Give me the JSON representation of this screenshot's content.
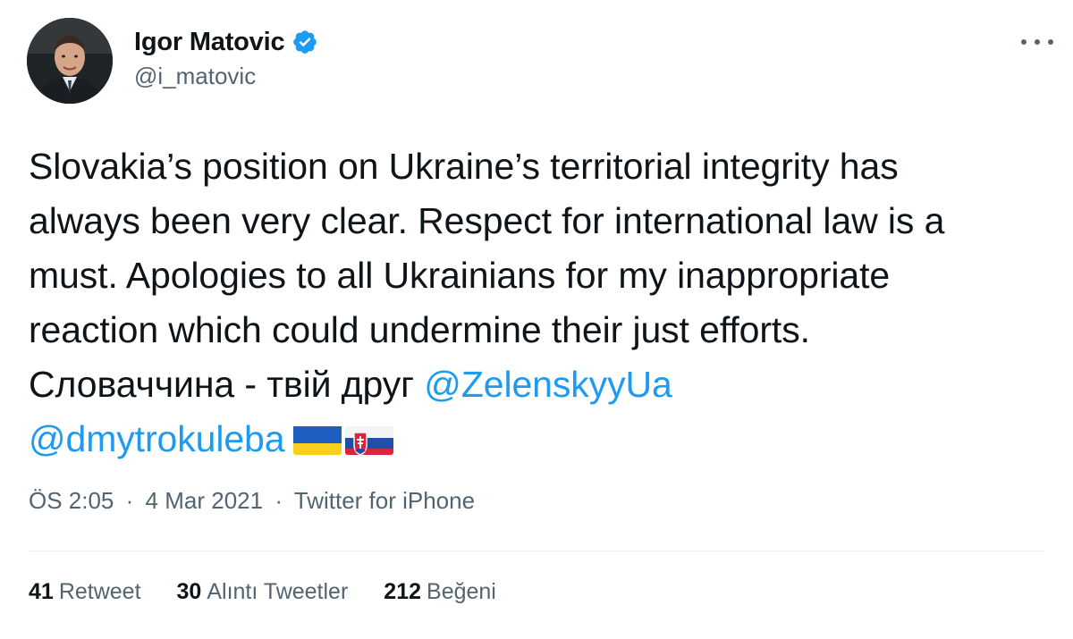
{
  "author": {
    "display_name": "Igor Matovic",
    "handle": "@i_matovic",
    "verified": true
  },
  "tweet": {
    "lines": [
      "Slovakia’s position on Ukraine’s territorial integrity has",
      "always been very clear. Respect for international law is a",
      "must. Apologies to all Ukrainians for my inappropriate",
      "reaction which could undermine their just efforts."
    ],
    "line5_text": "Словаччина - твій друг ",
    "mention_1": "@ZelenskyyUa",
    "mention_2": "@dmytrokuleba",
    "flags": [
      "ukraine-flag",
      "slovakia-flag"
    ]
  },
  "meta": {
    "time": "ÖS 2:05",
    "separator": "·",
    "date": "4 Mar 2021",
    "source": "Twitter for iPhone"
  },
  "stats": {
    "retweets_count": "41",
    "retweets_label": "Retweet",
    "quotes_count": "30",
    "quotes_label": "Alıntı Tweetler",
    "likes_count": "212",
    "likes_label": "Beğeni"
  },
  "colors": {
    "accent": "#1d9bf0",
    "text": "#0f1419",
    "secondary": "#536471"
  },
  "icons": {
    "verified": "verified-badge-icon",
    "more": "more-options-icon"
  }
}
